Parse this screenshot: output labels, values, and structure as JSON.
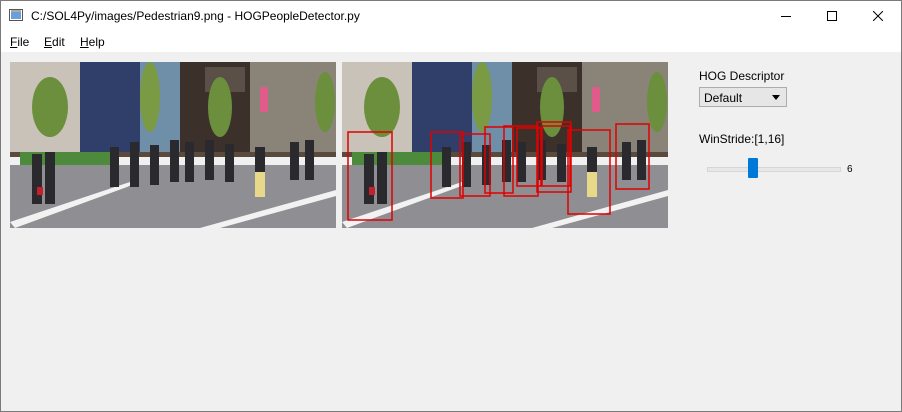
{
  "window": {
    "title": "C:/SOL4Py/images/Pedestrian9.png - HOGPeopleDetector.py",
    "controls": [
      "minimize-icon",
      "maximize-icon",
      "close-icon"
    ]
  },
  "menubar": {
    "items": [
      {
        "accel": "F",
        "rest": "ile"
      },
      {
        "accel": "E",
        "rest": "dit"
      },
      {
        "accel": "H",
        "rest": "elp"
      }
    ]
  },
  "images": {
    "original_icon": "street-photo",
    "detected_icon": "street-photo-with-detections",
    "detection_box_color": "#e00000",
    "detection_count": 10
  },
  "controls": {
    "hog_label": "HOG Descriptor",
    "hog_selected": "Default",
    "winstride_label": "WinStride:[1,16]",
    "winstride_min": 1,
    "winstride_max": 16,
    "winstride_value": "6",
    "accent_color": "#0078d7"
  }
}
